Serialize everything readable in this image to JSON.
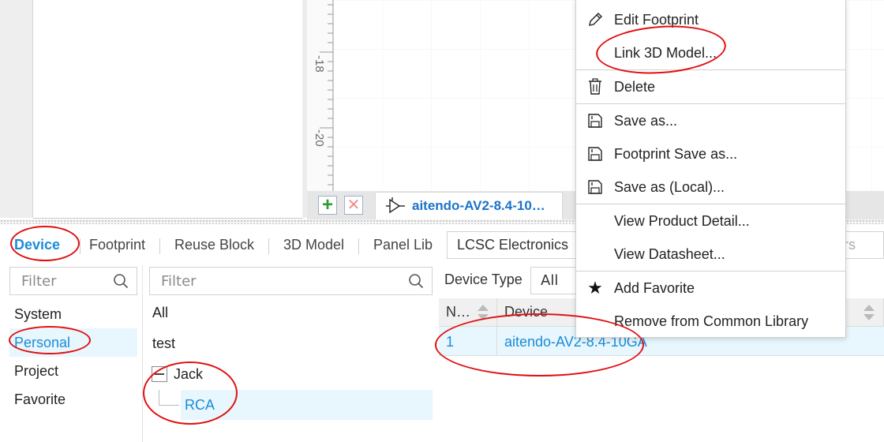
{
  "canvas": {
    "ruler_labels": [
      "-18",
      "-20"
    ],
    "active_tab": "aitendo-AV2-8.4-10…"
  },
  "context_menu": {
    "items": [
      {
        "label": "Edit Footprint",
        "icon": "pencil-icon"
      },
      {
        "label": "Link 3D Model...",
        "icon": ""
      },
      {
        "label": "Delete",
        "icon": "trash-icon"
      },
      {
        "label": "Save as...",
        "icon": "save-icon"
      },
      {
        "label": "Footprint Save as...",
        "icon": "save-icon"
      },
      {
        "label": "Save as (Local)...",
        "icon": "save-icon"
      },
      {
        "label": "View Product Detail...",
        "icon": ""
      },
      {
        "label": "View Datasheet...",
        "icon": ""
      },
      {
        "label": "Add Favorite",
        "icon": "star-icon"
      },
      {
        "label": "Remove from Common Library",
        "icon": ""
      }
    ]
  },
  "library": {
    "tabs": [
      "Device",
      "Footprint",
      "Reuse Block",
      "3D Model",
      "Panel Lib"
    ],
    "source_select": "LCSC Electronics",
    "right_filter_partial": "rs",
    "category_filter_placeholder": "Filter",
    "categories": [
      "System",
      "Personal",
      "Project",
      "Favorite"
    ],
    "tree_filter_placeholder": "Filter",
    "tree": {
      "all": "All",
      "test": "test",
      "jack": "Jack",
      "rca": "RCA"
    },
    "device_type_label": "Device Type",
    "device_type_value": "All",
    "table": {
      "headers": [
        "N…",
        "Device"
      ],
      "rows": [
        {
          "no": "1",
          "device": "aitendo-AV2-8.4-10GA"
        }
      ]
    }
  },
  "colors": {
    "accent": "#1a8cd8",
    "annotation": "#e01010",
    "selected_bg": "#e8f6fd"
  }
}
